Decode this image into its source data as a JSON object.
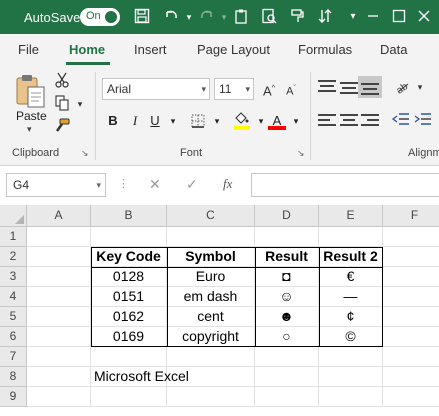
{
  "titlebar": {
    "autosave_label": "AutoSave",
    "toggle_state": "On",
    "accent": "#217346"
  },
  "tabs": [
    {
      "label": "File",
      "active": false
    },
    {
      "label": "Home",
      "active": true
    },
    {
      "label": "Insert",
      "active": false
    },
    {
      "label": "Page Layout",
      "active": false
    },
    {
      "label": "Formulas",
      "active": false
    },
    {
      "label": "Data",
      "active": false
    }
  ],
  "ribbon": {
    "clipboard": {
      "paste_label": "Paste",
      "group_label": "Clipboard"
    },
    "font": {
      "font_name": "Arial",
      "font_size": "11",
      "group_label": "Font",
      "fill_color": "#ffff00",
      "font_color": "#ff0000"
    },
    "alignment": {
      "group_label": "Alignm"
    }
  },
  "formula_bar": {
    "name_box": "G4",
    "formula": ""
  },
  "sheet": {
    "columns": [
      "A",
      "B",
      "C",
      "D",
      "E",
      "F"
    ],
    "rows": [
      "1",
      "2",
      "3",
      "4",
      "5",
      "6",
      "7",
      "8",
      "9"
    ],
    "table": {
      "headers": [
        "Key Code",
        "Symbol",
        "Result",
        "Result 2"
      ],
      "rows": [
        {
          "code": "0128",
          "symbol": "Euro",
          "result": "◘",
          "result2": "€"
        },
        {
          "code": "0151",
          "symbol": "em dash",
          "result": "☺",
          "result2": "—"
        },
        {
          "code": "0162",
          "symbol": "cent",
          "result": "☻",
          "result2": "¢"
        },
        {
          "code": "0169",
          "symbol": "copyright",
          "result": "○",
          "result2": "©"
        }
      ]
    },
    "note": "Microsoft Excel"
  }
}
